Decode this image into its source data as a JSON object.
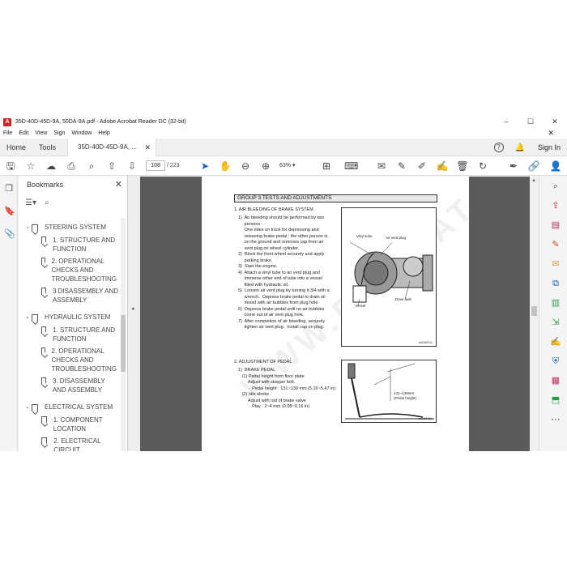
{
  "window": {
    "title": "35D-40D-45D-9A, 50DA-9A.pdf - Adobe Acrobat Reader DC (32-bit)",
    "minimize": "–",
    "maximize": "☐",
    "close": "✕"
  },
  "menu": [
    "File",
    "Edit",
    "View",
    "Sign",
    "Window",
    "Help"
  ],
  "menu_close": "✕",
  "tabs": {
    "home": "Home",
    "tools": "Tools",
    "document": "35D-40D-45D-9A, ...",
    "document_close": "✕",
    "help": "?",
    "signin": "Sign In"
  },
  "toolbar": {
    "page_current": "108",
    "page_total": "/ 223",
    "zoom": "63%"
  },
  "bookmarks": {
    "title": "Bookmarks",
    "close": "✕",
    "items": [
      {
        "type": "section",
        "label": "STEERING SYSTEM"
      },
      {
        "type": "child",
        "label": "1. STRUCTURE AND FUNCTION"
      },
      {
        "type": "child",
        "label": "2. OPERATIONAL CHECKS AND TROUBLESHOOTING"
      },
      {
        "type": "child",
        "label": "3 DISASSEMBLY AND ASSEMBLY"
      },
      {
        "type": "section",
        "label": "HYDRAULIC SYSTEM"
      },
      {
        "type": "child",
        "label": "1. STRUCTURE AND FUNCTION"
      },
      {
        "type": "child",
        "label": "2. OPERATIONAL CHECKS AND TROUBLESHOOTING"
      },
      {
        "type": "child",
        "label": "3. DISASSEMBLY AND ASSEMBLY"
      },
      {
        "type": "section",
        "label": "ELECTRICAL SYSTEM"
      },
      {
        "type": "child",
        "label": "1. COMPONENT LOCATION"
      },
      {
        "type": "child",
        "label": "2. ELECTRICAL CIRCUIT"
      }
    ]
  },
  "document": {
    "group_header": "GROUP  3  TESTS AND ADJUSTMENTS",
    "section1_title": "1. AIR BLEEDING OF BRAKE SYSTEM",
    "section1_steps": [
      "1)  Air bleeding should be performed by two",
      "     persons :",
      "     One rides on truck for depressing and",
      "     releasing brake pedal : the other person is",
      "     on the ground and removes cap from air",
      "     vent plug on wheel cylinder.",
      "2)  Block the front wheel securely and apply",
      "     parking brake.",
      "3)  Start the engine.",
      "4)  Attach a vinyl tube to air vent plug and",
      "     immerse other end of tube into a vessel",
      "     filled with hydraulic oil.",
      "5)  Loosen air vent plug by turning it 3/4 with a",
      "     wrench.  Depress brake pedal to drain oil",
      "     mixed with air bubbles from plug hole.",
      "6)  Depress brake pedal until no air bubbles",
      "     come out of air vent plug hole.",
      "7)  After completion of air bleeding, securely",
      "     tighten air vent plug.  Install cap on plug."
    ],
    "fig1": {
      "vinyl_tube": "Vinyl tube",
      "air_vent_plug": "Air vent plug",
      "vessel": "Vessel",
      "drive_axle": "Drive axle",
      "code": "sd2d6011"
    },
    "section2_title": "2. ADJUSTMENT OF PEDAL",
    "section2_lines": [
      "1)  BRAKE PEDAL",
      "   (1) Pedal height from floor plate",
      "        Adjust with stopper bolt.",
      "         · Pedal height : 131~139 mm (5.16~5.47 in)",
      "   (2) Idle stroke",
      "        Adjust with rod of brake valve",
      "         · Play : 2~4 mm (0.08~0.16 in)"
    ],
    "fig2": {
      "dim": "131~139mm",
      "dim_label": "(Pedal height)",
      "code": "sd2d6051"
    },
    "watermark": "WWW.EPC-DATA.COM"
  },
  "colors": {
    "accent": "#1a5fb4",
    "pdf_red": "#d42020",
    "doc_bg": "#5b5b5b"
  }
}
